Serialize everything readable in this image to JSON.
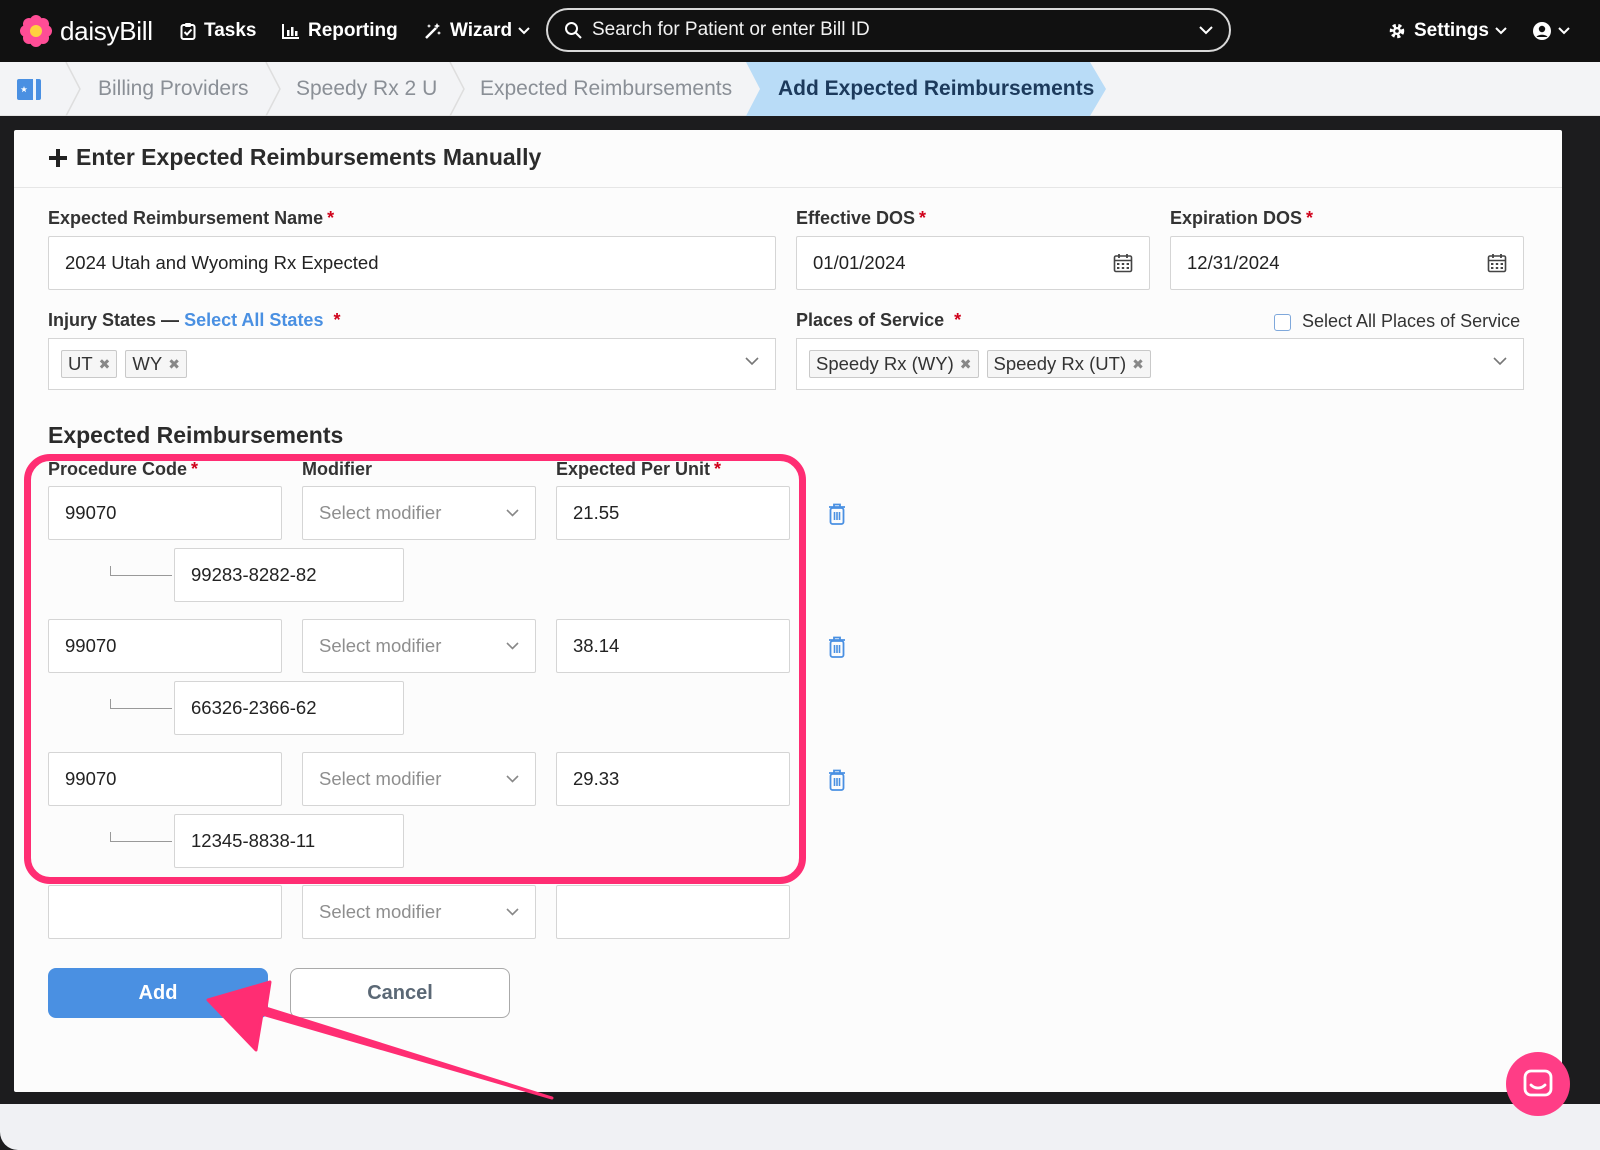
{
  "nav": {
    "brand": "daisyBill",
    "tasks": "Tasks",
    "reporting": "Reporting",
    "wizard": "Wizard",
    "search_placeholder": "Search for Patient or enter Bill ID",
    "settings": "Settings"
  },
  "breadcrumb": {
    "items": [
      "Billing Providers",
      "Speedy Rx 2 U",
      "Expected Reimbursements"
    ],
    "active": "Add Expected Reimbursements"
  },
  "form": {
    "title": "Enter Expected Reimbursements Manually",
    "name_label": "Expected Reimbursement Name",
    "name_value": "2024 Utah and Wyoming Rx Expected",
    "effective_label": "Effective DOS",
    "effective_value": "01/01/2024",
    "expiration_label": "Expiration DOS",
    "expiration_value": "12/31/2024",
    "injury_label": "Injury States —",
    "select_all_states": "Select All States",
    "injury_tags": [
      "UT",
      "WY"
    ],
    "places_label": "Places of Service",
    "select_all_places": "Select All Places of Service",
    "places_tags": [
      "Speedy Rx (WY)",
      "Speedy Rx (UT)"
    ],
    "section_title": "Expected Reimbursements",
    "col_procedure": "Procedure Code",
    "col_modifier": "Modifier",
    "col_expected": "Expected Per Unit",
    "rows": [
      {
        "code": "99070",
        "modifier": "Select modifier",
        "expected": "21.55",
        "ndc": "99283-8282-82"
      },
      {
        "code": "99070",
        "modifier": "Select modifier",
        "expected": "38.14",
        "ndc": "66326-2366-62"
      },
      {
        "code": "99070",
        "modifier": "Select modifier",
        "expected": "29.33",
        "ndc": "12345-8838-11"
      },
      {
        "code": "",
        "modifier": "Select modifier",
        "expected": ""
      }
    ],
    "add_label": "Add",
    "cancel_label": "Cancel"
  },
  "colors": {
    "accent": "#4a90e2",
    "highlight": "#ff2d73",
    "chat": "#ff3d86"
  }
}
